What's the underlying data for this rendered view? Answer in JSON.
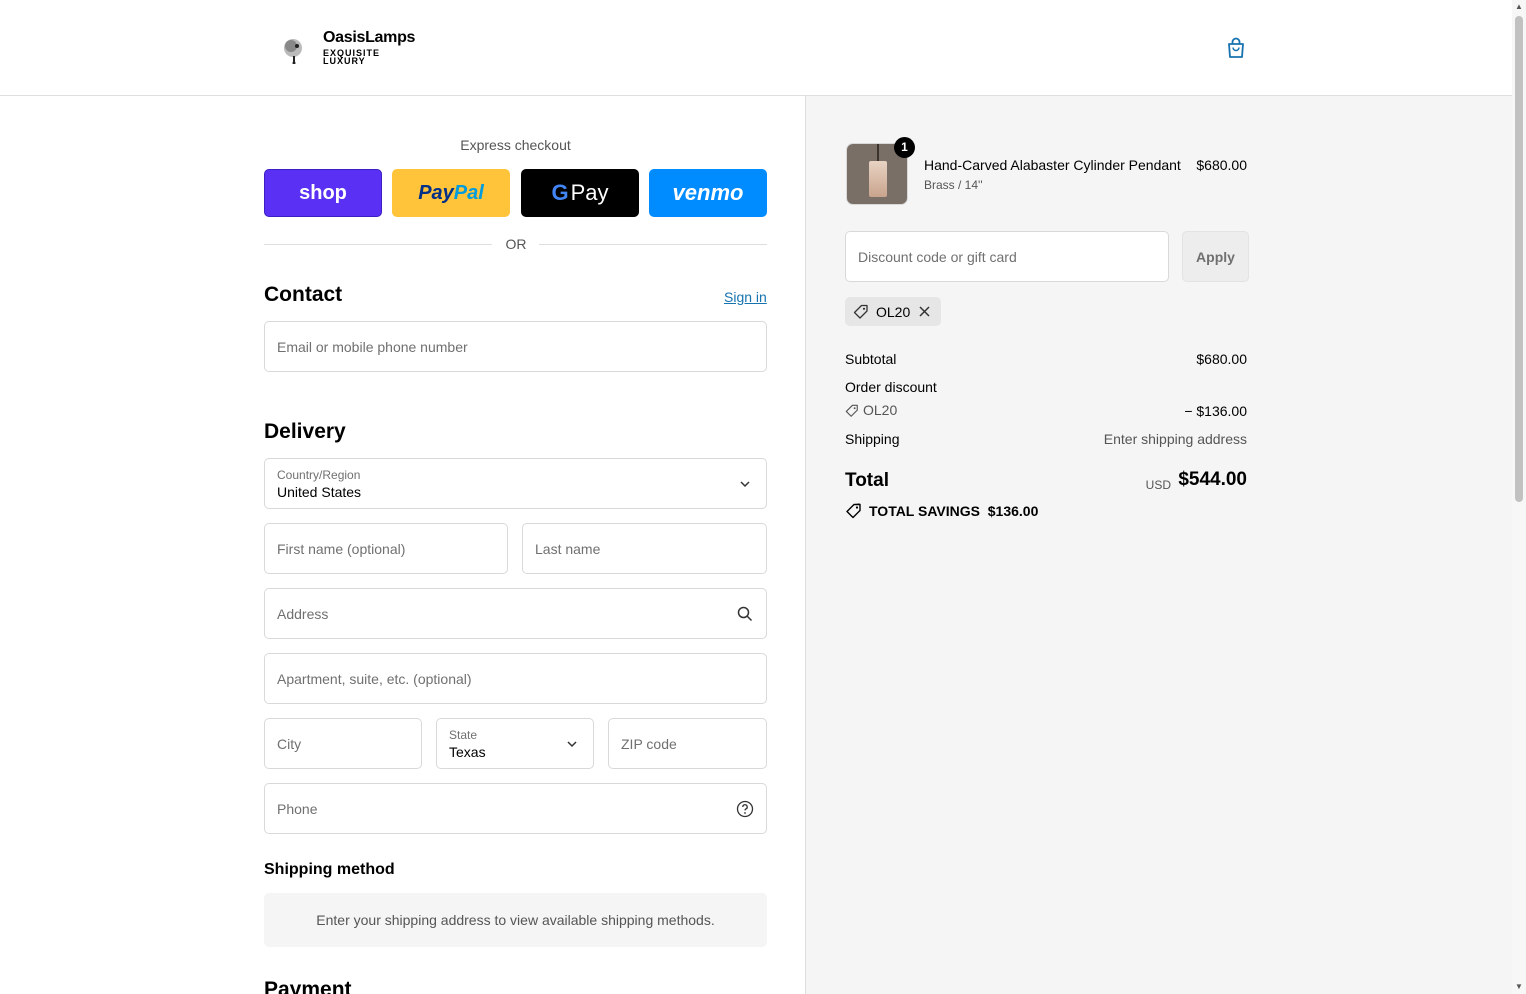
{
  "header": {
    "brand_name": "OasisLamps",
    "brand_tagline": "EXQUISITE LUXURY"
  },
  "express": {
    "label": "Express checkout",
    "buttons": {
      "shop": "shop",
      "paypal_1": "Pay",
      "paypal_2": "Pal",
      "gpay_g": "G",
      "gpay_text": "Pay",
      "venmo": "venmo"
    },
    "or": "OR"
  },
  "contact": {
    "title": "Contact",
    "signin": "Sign in",
    "email_placeholder": "Email or mobile phone number"
  },
  "delivery": {
    "title": "Delivery",
    "country_label": "Country/Region",
    "country_value": "United States",
    "first_name_placeholder": "First name (optional)",
    "last_name_placeholder": "Last name",
    "address_placeholder": "Address",
    "apartment_placeholder": "Apartment, suite, etc. (optional)",
    "city_placeholder": "City",
    "state_label": "State",
    "state_value": "Texas",
    "zip_placeholder": "ZIP code",
    "phone_placeholder": "Phone"
  },
  "shipping_method": {
    "title": "Shipping method",
    "message": "Enter your shipping address to view available shipping methods."
  },
  "payment": {
    "title": "Payment"
  },
  "summary": {
    "item": {
      "name": "Hand-Carved Alabaster Cylinder Pendant",
      "variant": "Brass / 14''",
      "price": "$680.00",
      "quantity": "1"
    },
    "discount_placeholder": "Discount code or gift card",
    "apply_label": "Apply",
    "applied_code": "OL20",
    "subtotal_label": "Subtotal",
    "subtotal_value": "$680.00",
    "order_discount_label": "Order discount",
    "discount_code": "OL20",
    "discount_value": "− $136.00",
    "shipping_label": "Shipping",
    "shipping_value": "Enter shipping address",
    "total_label": "Total",
    "currency": "USD",
    "total_value": "$544.00",
    "savings_label": "TOTAL SAVINGS",
    "savings_value": "$136.00"
  },
  "colors": {
    "shop_pay": "#5a31f4",
    "paypal": "#ffc439",
    "venmo": "#008cff",
    "link": "#1773b0",
    "summary_bg": "#f5f5f5"
  }
}
